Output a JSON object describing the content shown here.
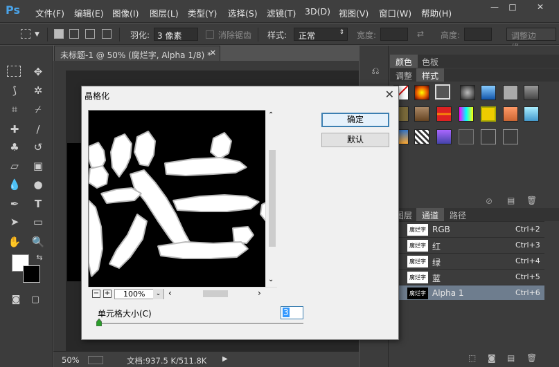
{
  "app": {
    "logo": "Ps",
    "accent": "#4aa3e8"
  },
  "menu": [
    "文件(F)",
    "编辑(E)",
    "图像(I)",
    "图层(L)",
    "类型(Y)",
    "选择(S)",
    "滤镜(T)",
    "3D(D)",
    "视图(V)",
    "窗口(W)",
    "帮助(H)"
  ],
  "options": {
    "feather_label": "羽化:",
    "feather_value": "3 像素",
    "antialias_label": "消除锯齿",
    "style_label": "样式:",
    "style_value": "正常",
    "width_label": "宽度:",
    "height_label": "高度:",
    "refine_button": "调整边缘..."
  },
  "document": {
    "tab_title": "未标题-1 @ 50% (腐烂字, Alpha 1/8) *",
    "zoom": "50%",
    "doc_size": "文档:937.5 K/511.8K"
  },
  "panels": {
    "color_tabs": [
      "颜色",
      "色板"
    ],
    "style_tabs": [
      "调整",
      "样式"
    ],
    "layer_tabs": [
      "图层",
      "通道",
      "路径"
    ],
    "channels": [
      {
        "name": "RGB",
        "shortcut": "Ctrl+2"
      },
      {
        "name": "红",
        "shortcut": "Ctrl+3"
      },
      {
        "name": "绿",
        "shortcut": "Ctrl+4"
      },
      {
        "name": "蓝",
        "shortcut": "Ctrl+5"
      },
      {
        "name": "Alpha 1",
        "shortcut": "Ctrl+6",
        "selected": true
      }
    ],
    "thumb_text": "腐烂字"
  },
  "dialog": {
    "title": "晶格化",
    "ok": "确定",
    "default": "默认",
    "zoom": "100%",
    "cell_size_label": "单元格大小(C)",
    "cell_size_value": "3"
  }
}
